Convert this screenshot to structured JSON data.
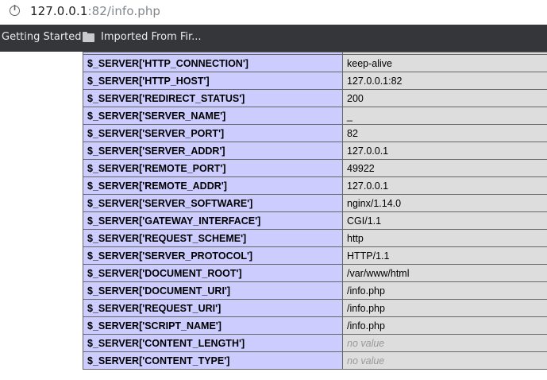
{
  "browser": {
    "url_host": "127.0.0.1",
    "url_rest": ":82/info.php",
    "bookmarks": {
      "getting_started": "Getting Started",
      "imported": "Imported From Fir..."
    }
  },
  "table": {
    "rows": [
      {
        "key": "$_SERVER['HTTP_CONNECTION']",
        "value": "keep-alive"
      },
      {
        "key": "$_SERVER['HTTP_HOST']",
        "value": "127.0.0.1:82"
      },
      {
        "key": "$_SERVER['REDIRECT_STATUS']",
        "value": "200"
      },
      {
        "key": "$_SERVER['SERVER_NAME']",
        "value": "_"
      },
      {
        "key": "$_SERVER['SERVER_PORT']",
        "value": "82"
      },
      {
        "key": "$_SERVER['SERVER_ADDR']",
        "value": "127.0.0.1"
      },
      {
        "key": "$_SERVER['REMOTE_PORT']",
        "value": "49922"
      },
      {
        "key": "$_SERVER['REMOTE_ADDR']",
        "value": "127.0.0.1"
      },
      {
        "key": "$_SERVER['SERVER_SOFTWARE']",
        "value": "nginx/1.14.0"
      },
      {
        "key": "$_SERVER['GATEWAY_INTERFACE']",
        "value": "CGI/1.1"
      },
      {
        "key": "$_SERVER['REQUEST_SCHEME']",
        "value": "http"
      },
      {
        "key": "$_SERVER['SERVER_PROTOCOL']",
        "value": "HTTP/1.1"
      },
      {
        "key": "$_SERVER['DOCUMENT_ROOT']",
        "value": "/var/www/html"
      },
      {
        "key": "$_SERVER['DOCUMENT_URI']",
        "value": "/info.php"
      },
      {
        "key": "$_SERVER['REQUEST_URI']",
        "value": "/info.php"
      },
      {
        "key": "$_SERVER['SCRIPT_NAME']",
        "value": "/info.php"
      },
      {
        "key": "$_SERVER['CONTENT_LENGTH']",
        "value": "no value",
        "novalue": true
      },
      {
        "key": "$_SERVER['CONTENT_TYPE']",
        "value": "no value",
        "novalue": true
      }
    ]
  },
  "colors": {
    "key_cell_bg": "#ccccff",
    "value_cell_bg": "#dddddd",
    "bookmark_bar_bg": "#35363a"
  }
}
